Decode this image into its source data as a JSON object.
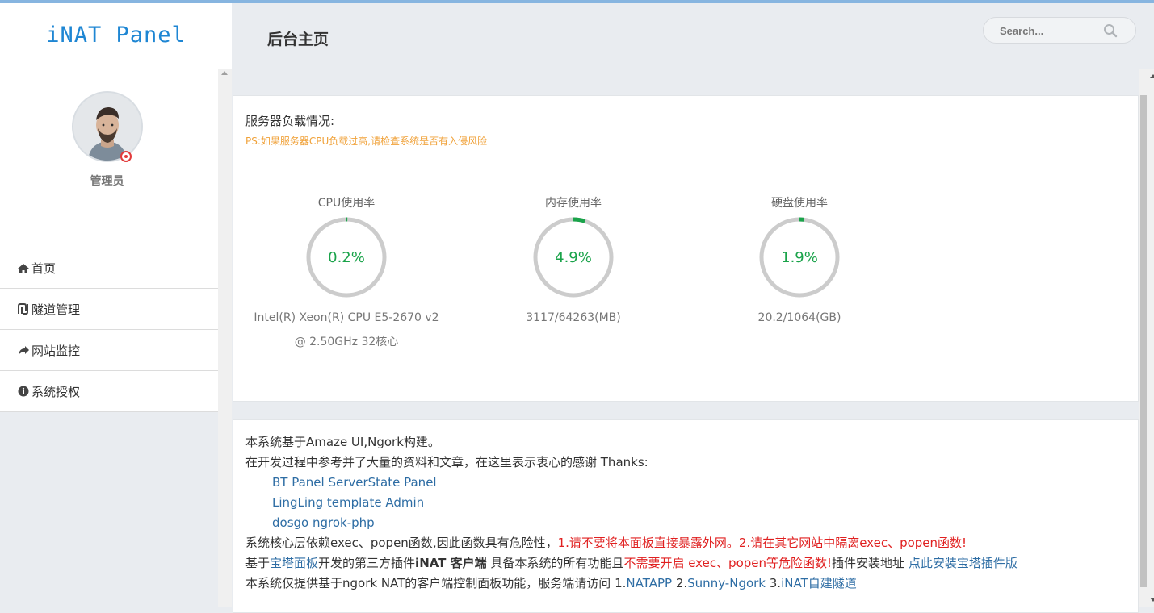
{
  "app": {
    "logo": "iNAT Panel",
    "page_title": "后台主页",
    "search_placeholder": "Search..."
  },
  "sidebar": {
    "user_role": "管理员",
    "items": [
      {
        "label": "首页",
        "icon": "home-icon"
      },
      {
        "label": "隧道管理",
        "icon": "tunnel-icon"
      },
      {
        "label": "网站监控",
        "icon": "share-arrow-icon"
      },
      {
        "label": "系统授权",
        "icon": "info-circle-icon"
      }
    ]
  },
  "load": {
    "title": "服务器负载情况:",
    "note": "PS:如果服务器CPU负载过高,请检查系统是否有入侵风险",
    "gauges": [
      {
        "label": "CPU使用率",
        "value_text": "0.2%",
        "fraction": 0.002,
        "detail": [
          "Intel(R) Xeon(R) CPU E5-2670 v2",
          "@ 2.50GHz 32核心"
        ]
      },
      {
        "label": "内存使用率",
        "value_text": "4.9%",
        "fraction": 0.049,
        "detail": [
          "3117/64263(MB)"
        ]
      },
      {
        "label": "硬盘使用率",
        "value_text": "1.9%",
        "fraction": 0.019,
        "detail": [
          "20.2/1064(GB)"
        ]
      }
    ],
    "gauge_color": "#1aa34a",
    "track_color": "#cccccc"
  },
  "info": {
    "line1": "本系统基于Amaze UI,Ngork构建。",
    "line2": "在开发过程中参考并了大量的资料和文章，在这里表示衷心的感谢 Thanks:",
    "credits": [
      "BT Panel ServerState Panel",
      "LingLing template Admin",
      "dosgo ngrok-php"
    ],
    "warn_prefix": "系统核心层依赖exec、popen函数,因此函数具有危险性，",
    "warn_red": "1.请不要将本面板直接暴露外网。2.请在其它网站中隔离exec、popen函数!",
    "plugin_a": "基于",
    "plugin_link": "宝塔面板",
    "plugin_b": "开发的第三方插件",
    "plugin_bold": "iNAT 客户端",
    "plugin_c": " 具备本系统的所有功能且",
    "plugin_red": "不需要开启 exec、popen等危险函数!",
    "plugin_d": "插件安装地址 ",
    "plugin_link2": "点此安装宝塔插件版",
    "server_a": "本系统仅提供基于ngork NAT的客户端控制面板功能，服务端请访问 1.",
    "server_link1": "NATAPP",
    "server_b": " 2.",
    "server_link2": "Sunny-Ngork",
    "server_c": " 3.",
    "server_link3": "iNAT自建隧道"
  }
}
